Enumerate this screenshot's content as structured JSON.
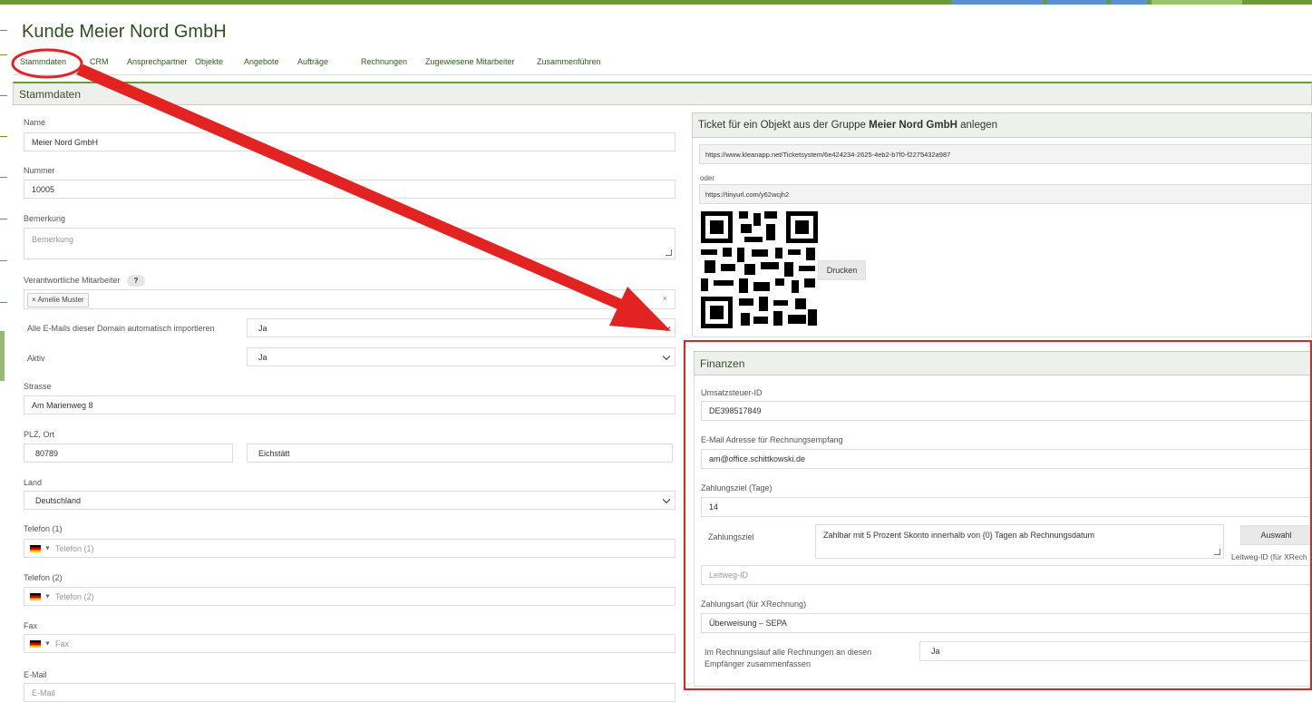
{
  "page": {
    "title": "Kunde Meier Nord GmbH"
  },
  "tabs": [
    "Stammdaten",
    "CRM",
    "Ansprechpartner",
    "Objekte",
    "Angebote",
    "Aufträge",
    "Rechnungen",
    "Zugewiesene Mitarbeiter",
    "Zusammenführen"
  ],
  "stammdaten": {
    "header": "Stammdaten",
    "name_label": "Name",
    "name_value": "Meier Nord GmbH",
    "nummer_label": "Nummer",
    "nummer_value": "10005",
    "bemerkung_label": "Bemerkung",
    "bemerkung_placeholder": "Bemerkung",
    "mitarbeiter_label": "Verantwortliche Mitarbeiter",
    "help_glyph": "?",
    "mitarbeiter_tag": "× Amelie Muster",
    "clear_glyph": "×",
    "email_import_label": "Alle E-Mails dieser Domain automatisch importieren",
    "email_import_value": "Ja",
    "aktiv_label": "Aktiv",
    "aktiv_value": "Ja",
    "strasse_label": "Strasse",
    "strasse_value": "Am Marienweg 8",
    "plz_ort_label": "PLZ, Ort",
    "plz_value": "80789",
    "ort_value": "Eichstätt",
    "land_label": "Land",
    "land_value": "Deutschland",
    "telefon1_label": "Telefon (1)",
    "telefon1_placeholder": "Telefon (1)",
    "telefon2_label": "Telefon (2)",
    "telefon2_placeholder": "Telefon (2)",
    "fax_label": "Fax",
    "fax_placeholder": "Fax",
    "email_label": "E-Mail",
    "email_placeholder": "E-Mail"
  },
  "ticket": {
    "header_prefix": "Ticket für ein Objekt aus der Gruppe ",
    "header_group": "Meier Nord GmbH",
    "header_suffix": " anlegen",
    "url_long": "https://www.kleanapp.net/Ticketsystem/6e424234-2625-4eb2-b7f0-f2275432a987",
    "oder": "oder",
    "url_short": "https://tinyurl.com/y62wcjh2",
    "print_button": "Drucken"
  },
  "finanzen": {
    "header": "Finanzen",
    "ust_label": "Umsatzsteuer-ID",
    "ust_value": "DE398517849",
    "rechnung_email_label": "E-Mail Adresse für Rechnungsempfang",
    "rechnung_email_value": "am@office.schittkowski.de",
    "zahlungsziel_tage_label": "Zahlungsziel (Tage)",
    "zahlungsziel_tage_value": "14",
    "zahlungsziel_label": "Zahlungsziel",
    "zahlungsziel_text": "Zahlbar mit 5 Prozent Skonto innerhalb von {0} Tagen ab Rechnungsdatum",
    "auswahl_button": "Auswahl",
    "leitweg_side_label": "Leitweg-ID (für XRech",
    "leitweg_placeholder": "Leitweg-ID",
    "zahlungsart_label": "Zahlungsart (für XRechnung)",
    "zahlungsart_value": "Überweisung – SEPA",
    "zusammenfassen_label": "Im Rechnungslauf alle Rechnungen an diesen Empfänger zusammenfassen",
    "zusammenfassen_value": "Ja"
  },
  "colors": {
    "accent": "#6a9a3a",
    "annotation": "#e32222",
    "tab_text": "#2d5a1e"
  }
}
